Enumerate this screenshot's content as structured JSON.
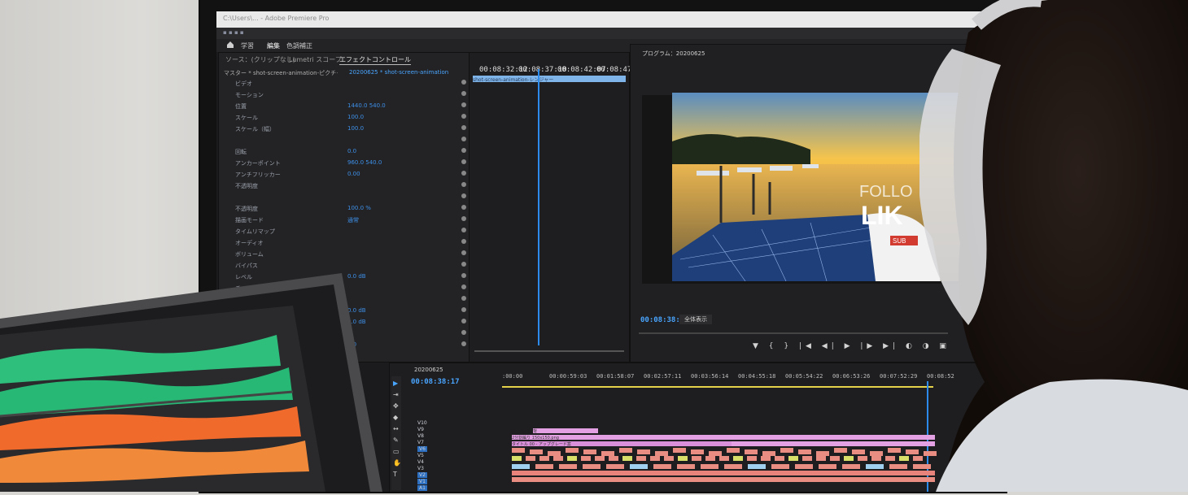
{
  "window_title": "C:\\Users\\... - Adobe Premiere Pro",
  "workspace_tabs": [
    "学習",
    "編集",
    "色調補正"
  ],
  "panels": {
    "left_tabs": [
      "ソース：(クリップなし)",
      "Lumetri スコープ",
      "エフェクトコントロール"
    ],
    "source_clip": "マスター * shot-screen-animation-ピクチャー",
    "sequence_clip": "20200625 * shot-screen-animation",
    "effect_rows": [
      {
        "label": "ビデオ",
        "value": ""
      },
      {
        "label": "モーション",
        "value": ""
      },
      {
        "label": "位置",
        "value": "1440.0   540.0"
      },
      {
        "label": "スケール",
        "value": "100.0"
      },
      {
        "label": "スケール（幅）",
        "value": "100.0"
      },
      {
        "label": "",
        "value": ""
      },
      {
        "label": "回転",
        "value": "0.0"
      },
      {
        "label": "アンカーポイント",
        "value": "960.0   540.0"
      },
      {
        "label": "アンチフリッカー",
        "value": "0.00"
      },
      {
        "label": "不透明度",
        "value": ""
      },
      {
        "label": "",
        "value": ""
      },
      {
        "label": "不透明度",
        "value": "100.0 %"
      },
      {
        "label": "描画モード",
        "value": "通常"
      },
      {
        "label": "タイムリマップ",
        "value": ""
      },
      {
        "label": "オーディオ",
        "value": ""
      },
      {
        "label": "ボリューム",
        "value": ""
      },
      {
        "label": "バイパス",
        "value": ""
      },
      {
        "label": "レベル",
        "value": "0.0 dB"
      },
      {
        "label": "チャンネルボリューム",
        "value": ""
      },
      {
        "label": "バイパス",
        "value": ""
      },
      {
        "label": "左",
        "value": "0.0 dB"
      },
      {
        "label": "右",
        "value": "0.0 dB"
      },
      {
        "label": "パンナー",
        "value": ""
      },
      {
        "label": "バランス",
        "value": "0.0"
      }
    ],
    "mini_timecodes": [
      "00:08:32:12",
      "00:08:37:10",
      "00:08:42:07",
      "00:08:47:05"
    ],
    "mini_clip_label": "shot-screen-animation-レンジャー"
  },
  "program": {
    "title": "プログラム：20200625",
    "timecode": "00:08:38:17",
    "zoom": "全体表示",
    "overlay_text_1": "FOLLO",
    "overlay_text_2": "LIK",
    "overlay_text_3": "SUB"
  },
  "timeline": {
    "sequence": "20200625",
    "timecode": "00:08:38:17",
    "ruler": [
      ":00:00",
      "00:00:59:03",
      "00:01:58:07",
      "00:02:57:11",
      "00:03:56:14",
      "00:04:55:18",
      "00:05:54:22",
      "00:06:53:26",
      "00:07:52:29",
      "00:08:52"
    ],
    "video_tracks": [
      "V10",
      "V9",
      "V8",
      "V7",
      "V6",
      "V5",
      "V4",
      "V3",
      "V2",
      "V1"
    ],
    "audio_tracks": [
      "A1"
    ],
    "clip_labels": [
      "背",
      "2分割編り 150x150.png",
      "タイトル 00 - アップグレード案"
    ]
  },
  "colors": {
    "accent_blue": "#2d8ceb",
    "clip_pink": "#e3a0e3",
    "clip_salmon": "#e98d83",
    "wave_green": "#2fcf86",
    "wave_orange": "#f06a2c"
  }
}
